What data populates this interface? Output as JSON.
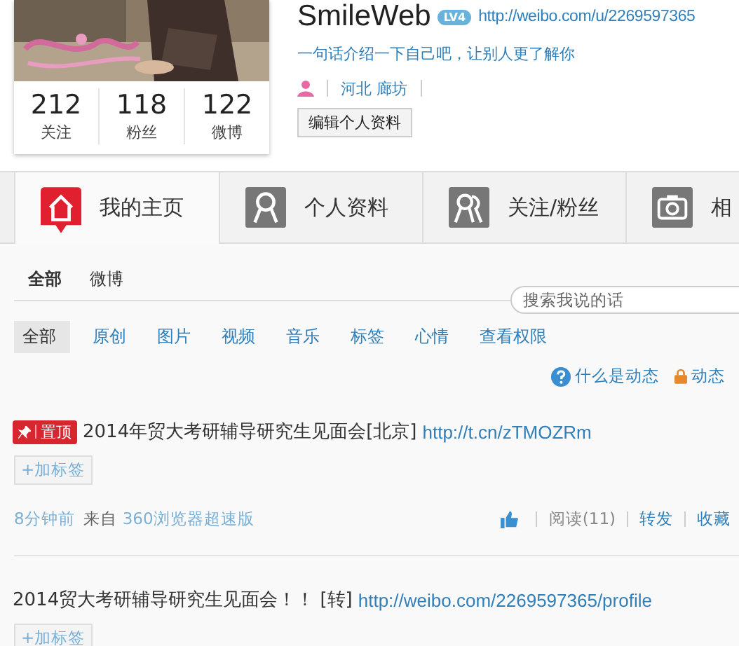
{
  "profile": {
    "stats": [
      {
        "value": "212",
        "label": "关注"
      },
      {
        "value": "118",
        "label": "粉丝"
      },
      {
        "value": "122",
        "label": "微博"
      }
    ],
    "name": "SmileWeb",
    "level": "LV4",
    "url": "http://weibo.com/u/2269597365",
    "intro": "一句话介绍一下自己吧，让别人更了解你",
    "location": "河北 廊坊",
    "edit_button": "编辑个人资料"
  },
  "tabs": [
    {
      "kind": "home",
      "label": "我的主页",
      "selected": true
    },
    {
      "kind": "person",
      "label": "个人资料",
      "selected": false
    },
    {
      "kind": "people",
      "label": "关注/粉丝",
      "selected": false
    },
    {
      "kind": "camera",
      "label": "相",
      "selected": false
    }
  ],
  "feed_tabs": [
    {
      "label": "全部",
      "selected": true
    },
    {
      "label": "微博",
      "selected": false
    }
  ],
  "search": {
    "placeholder": "搜索我说的话"
  },
  "filters": [
    {
      "label": "全部",
      "selected": true
    },
    {
      "label": "原创",
      "selected": false
    },
    {
      "label": "图片",
      "selected": false
    },
    {
      "label": "视频",
      "selected": false
    },
    {
      "label": "音乐",
      "selected": false
    },
    {
      "label": "标签",
      "selected": false
    },
    {
      "label": "心情",
      "selected": false
    },
    {
      "label": "查看权限",
      "selected": false
    }
  ],
  "help_links": [
    {
      "kind": "help",
      "label": "什么是动态"
    },
    {
      "kind": "lock",
      "label": "动态"
    }
  ],
  "posts": [
    {
      "pinned": true,
      "pin_label": "置顶",
      "text": "2014年贸大考研辅导研究生见面会[北京]",
      "link": "http://t.cn/zTMOZRm",
      "tag_button": "+加标签",
      "time": "8分钟前",
      "source_prefix": "来自",
      "source": "360浏览器超速版",
      "actions": [
        "阅读(11)",
        "转发",
        "收藏"
      ]
    },
    {
      "pinned": false,
      "text": "2014贸大考研辅导研究生见面会！！ [转]",
      "link": "http://weibo.com/2269597365/profile",
      "tag_button": "+加标签"
    }
  ]
}
